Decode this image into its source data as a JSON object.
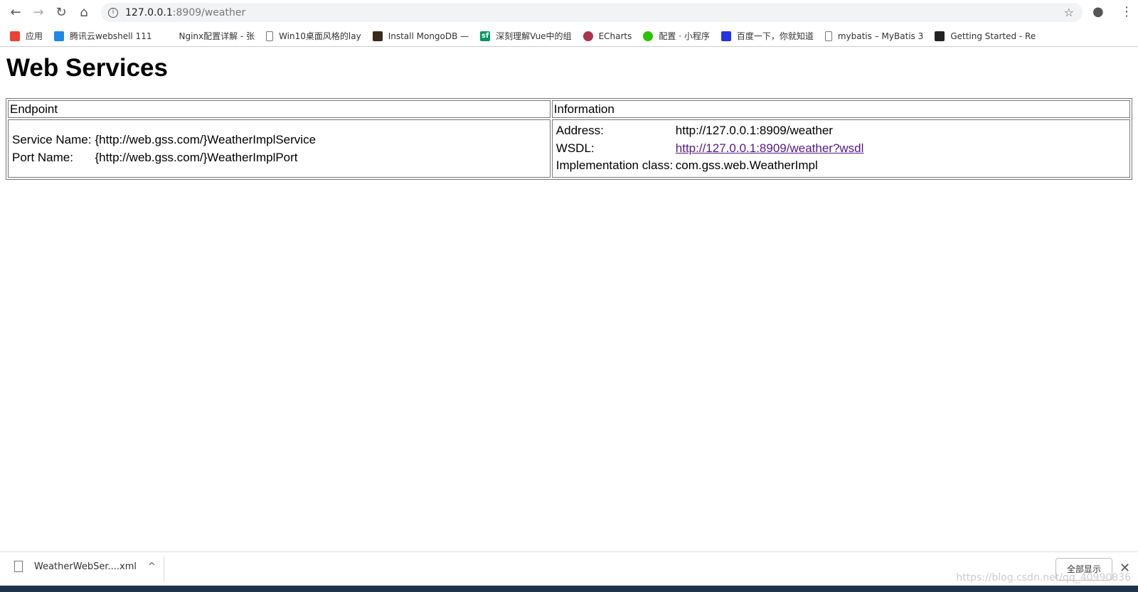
{
  "browser": {
    "url_host": "127.0.0.1",
    "url_path": ":8909/weather"
  },
  "bookmarks": [
    {
      "label": "应用",
      "icon": "apps-grid-icon",
      "color": "#e94235"
    },
    {
      "label": "腾讯云webshell 111",
      "icon": "cloud-icon",
      "color": "#1e88e5"
    },
    {
      "label": "Nginx配置详解 - 张",
      "icon": "site-icon",
      "color": "#555555"
    },
    {
      "label": "Win10桌面风格的lay",
      "icon": "page-icon",
      "color": "#777777"
    },
    {
      "label": "Install MongoDB —",
      "icon": "mongodb-leaf-icon",
      "color": "#3a2a1a"
    },
    {
      "label": "深刻理解Vue中的组",
      "icon": "sf-icon",
      "color": "#009a61"
    },
    {
      "label": "ECharts",
      "icon": "echarts-icon",
      "color": "#aa344d"
    },
    {
      "label": "配置 · 小程序",
      "icon": "wechat-icon",
      "color": "#2dc100"
    },
    {
      "label": "百度一下，你就知道",
      "icon": "baidu-paw-icon",
      "color": "#2932e1"
    },
    {
      "label": "mybatis – MyBatis 3",
      "icon": "page-icon",
      "color": "#777777"
    },
    {
      "label": "Getting Started - Re",
      "icon": "react-icon",
      "color": "#222222"
    }
  ],
  "page": {
    "title": "Web Services",
    "headers": [
      "Endpoint",
      "Information"
    ],
    "endpoint": {
      "service_label": "Service Name:",
      "service_value": "{http://web.gss.com/}WeatherImplService",
      "port_label": "Port Name:",
      "port_value": "{http://web.gss.com/}WeatherImplPort"
    },
    "info": {
      "address_label": "Address:",
      "address_value": "http://127.0.0.1:8909/weather",
      "wsdl_label": "WSDL:",
      "wsdl_value": "http://127.0.0.1:8909/weather?wsdl",
      "impl_label": "Implementation class:",
      "impl_value": "com.gss.web.WeatherImpl"
    }
  },
  "downloads": {
    "file": "WeatherWebSer....xml",
    "show_all": "全部显示"
  },
  "watermark": "https://blog.csdn.net/qq_40990836"
}
